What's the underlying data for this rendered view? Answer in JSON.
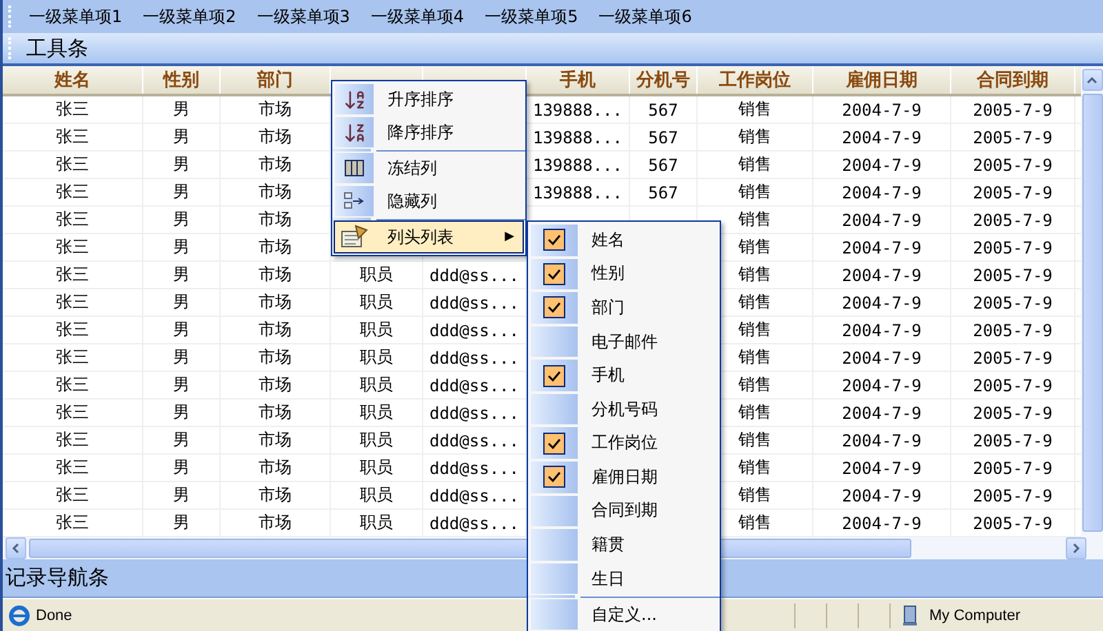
{
  "menubar": {
    "items": [
      "一级菜单项1",
      "一级菜单项2",
      "一级菜单项3",
      "一级菜单项4",
      "一级菜单项5",
      "一级菜单项6"
    ]
  },
  "toolbar": {
    "title": "工具条"
  },
  "grid": {
    "columns": [
      "姓名",
      "性别",
      "部门",
      null,
      null,
      "手机",
      "分机号",
      "工作岗位",
      "雇佣日期",
      "合同到期"
    ],
    "rows": [
      {
        "cells": [
          "张三",
          "男",
          "市场",
          null,
          null,
          "139888...",
          "567",
          "销售",
          "2004-7-9",
          "2005-7-9"
        ]
      },
      {
        "cells": [
          "张三",
          "男",
          "市场",
          null,
          null,
          "139888...",
          "567",
          "销售",
          "2004-7-9",
          "2005-7-9"
        ]
      },
      {
        "cells": [
          "张三",
          "男",
          "市场",
          null,
          null,
          "139888...",
          "567",
          "销售",
          "2004-7-9",
          "2005-7-9"
        ]
      },
      {
        "cells": [
          "张三",
          "男",
          "市场",
          null,
          null,
          "139888...",
          "567",
          "销售",
          "2004-7-9",
          "2005-7-9"
        ]
      },
      {
        "cells": [
          "张三",
          "男",
          "市场",
          null,
          null,
          null,
          null,
          "销售",
          "2004-7-9",
          "2005-7-9"
        ]
      },
      {
        "cells": [
          "张三",
          "男",
          "市场",
          null,
          null,
          null,
          null,
          "销售",
          "2004-7-9",
          "2005-7-9"
        ]
      },
      {
        "cells": [
          "张三",
          "男",
          "市场",
          "职员",
          "ddd@ss...",
          null,
          null,
          "销售",
          "2004-7-9",
          "2005-7-9"
        ]
      },
      {
        "cells": [
          "张三",
          "男",
          "市场",
          "职员",
          "ddd@ss...",
          null,
          null,
          "销售",
          "2004-7-9",
          "2005-7-9"
        ]
      },
      {
        "cells": [
          "张三",
          "男",
          "市场",
          "职员",
          "ddd@ss...",
          null,
          null,
          "销售",
          "2004-7-9",
          "2005-7-9"
        ]
      },
      {
        "cells": [
          "张三",
          "男",
          "市场",
          "职员",
          "ddd@ss...",
          null,
          null,
          "销售",
          "2004-7-9",
          "2005-7-9"
        ]
      },
      {
        "cells": [
          "张三",
          "男",
          "市场",
          "职员",
          "ddd@ss...",
          null,
          null,
          "销售",
          "2004-7-9",
          "2005-7-9"
        ]
      },
      {
        "cells": [
          "张三",
          "男",
          "市场",
          "职员",
          "ddd@ss...",
          null,
          null,
          "销售",
          "2004-7-9",
          "2005-7-9"
        ]
      },
      {
        "cells": [
          "张三",
          "男",
          "市场",
          "职员",
          "ddd@ss...",
          null,
          null,
          "销售",
          "2004-7-9",
          "2005-7-9"
        ]
      },
      {
        "cells": [
          "张三",
          "男",
          "市场",
          "职员",
          "ddd@ss...",
          null,
          null,
          "销售",
          "2004-7-9",
          "2005-7-9"
        ]
      },
      {
        "cells": [
          "张三",
          "男",
          "市场",
          "职员",
          "ddd@ss...",
          null,
          null,
          "销售",
          "2004-7-9",
          "2005-7-9"
        ]
      },
      {
        "cells": [
          "张三",
          "男",
          "市场",
          "职员",
          "ddd@ss...",
          null,
          null,
          "销售",
          "2004-7-9",
          "2005-7-9"
        ]
      }
    ]
  },
  "context_menu": {
    "items": [
      {
        "kind": "sort-asc",
        "label": "升序排序",
        "selected": false
      },
      {
        "kind": "sort-desc",
        "label": "降序排序",
        "selected": false
      },
      {
        "kind": "separator"
      },
      {
        "kind": "freeze",
        "label": "冻结列",
        "selected": false
      },
      {
        "kind": "hide",
        "label": "隐藏列",
        "selected": false
      },
      {
        "kind": "separator"
      },
      {
        "kind": "columns",
        "label": "列头列表",
        "selected": true,
        "arrow": "▶"
      }
    ]
  },
  "column_list": {
    "items": [
      {
        "label": "姓名",
        "checked": true
      },
      {
        "label": "性别",
        "checked": true
      },
      {
        "label": "部门",
        "checked": true
      },
      {
        "label": "电子邮件",
        "checked": false
      },
      {
        "label": "手机",
        "checked": true
      },
      {
        "label": "分机号码",
        "checked": false
      },
      {
        "label": "工作岗位",
        "checked": true
      },
      {
        "label": "雇佣日期",
        "checked": true
      },
      {
        "label": "合同到期",
        "checked": false
      },
      {
        "label": "籍贯",
        "checked": false
      },
      {
        "label": "生日",
        "checked": false
      }
    ],
    "footer": "自定义..."
  },
  "navigator": {
    "title": "记录导航条"
  },
  "status_bar": {
    "text": "Done",
    "zone": "My Computer"
  }
}
